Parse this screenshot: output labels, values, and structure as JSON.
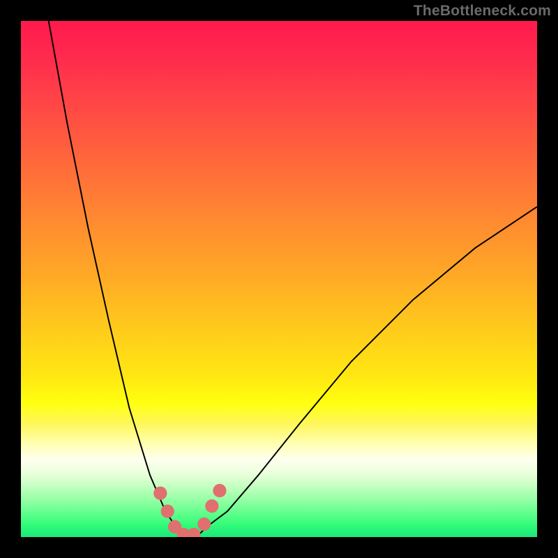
{
  "watermark": "TheBottleneck.com",
  "colors": {
    "gradient_top": "#ff1a4d",
    "gradient_mid": "#ffff10",
    "gradient_bottom": "#1be87a",
    "curve": "#000000",
    "beads": "#e06f6f",
    "frame": "#000000"
  },
  "chart_data": {
    "type": "line",
    "title": "",
    "xlabel": "",
    "ylabel": "",
    "xlim": [
      0,
      100
    ],
    "ylim": [
      0,
      100
    ],
    "grid": false,
    "series": [
      {
        "name": "bottleneck-curve",
        "x": [
          5,
          9,
          13,
          17,
          21,
          25,
          28,
          30,
          32,
          34,
          36,
          40,
          46,
          54,
          64,
          76,
          88,
          100
        ],
        "y": [
          102,
          80,
          60,
          42,
          25,
          12,
          5,
          2,
          0,
          0,
          2,
          5,
          12,
          22,
          34,
          46,
          56,
          64
        ]
      }
    ],
    "beads": {
      "name": "highlight-points",
      "x": [
        27.0,
        28.4,
        29.8,
        31.5,
        33.5,
        35.5,
        37.0,
        38.5
      ],
      "y": [
        8.5,
        5.0,
        2.0,
        0.5,
        0.5,
        2.5,
        6.0,
        9.0
      ],
      "radius_pct": 1.3
    }
  }
}
